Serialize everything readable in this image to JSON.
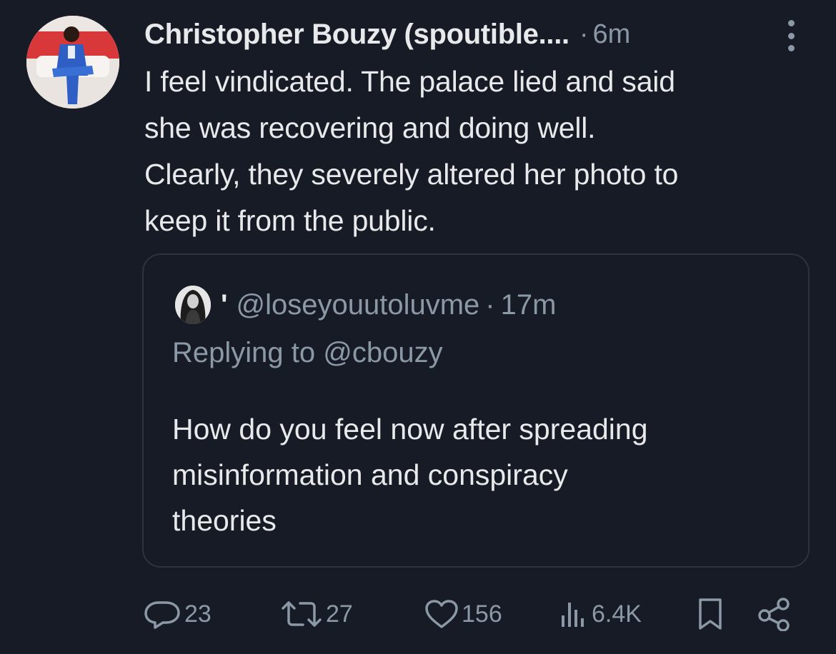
{
  "tweet": {
    "author_name": "Christopher Bouzy (spoutible....",
    "separator": "·",
    "timestamp": "6m",
    "text_lines": [
      "I feel vindicated. The palace lied and said",
      "she was recovering and doing well.",
      "Clearly, they severely altered her photo to",
      "keep it from the public."
    ]
  },
  "quoted": {
    "apostrophe": "'",
    "handle": "@loseyouutoluvme",
    "separator": "·",
    "timestamp": "17m",
    "replying_to": "Replying to @cbouzy",
    "text_lines": [
      "How do you feel now after spreading",
      "misinformation and conspiracy",
      "theories"
    ]
  },
  "actions": {
    "replies": "23",
    "retweets": "27",
    "likes": "156",
    "views": "6.4K"
  },
  "icons": {
    "reply": "reply-icon",
    "retweet": "retweet-icon",
    "like": "heart-icon",
    "views": "views-icon",
    "bookmark": "bookmark-icon",
    "share": "share-icon",
    "more": "more-vertical-icon"
  },
  "colors": {
    "background": "#161b26",
    "text_primary": "#e7e9ea",
    "text_secondary": "#8b98a5",
    "quote_border": "#2b3440",
    "avatar_banner": "#d8383a",
    "avatar_suit": "#2f5fc4"
  }
}
